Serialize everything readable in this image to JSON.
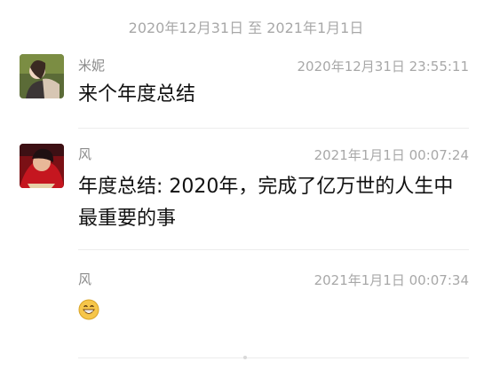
{
  "header": {
    "date_range": "2020年12月31日 至 2021年1月1日"
  },
  "messages": [
    {
      "sender": "米妮",
      "time": "2020年12月31日 23:55:11",
      "text": "来个年度总结",
      "avatar_icon": "user-photo-icon"
    },
    {
      "sender": "风",
      "time": "2021年1月1日 00:07:24",
      "text_line1": "年度总结: 2020年，完成了亿万世的人生中",
      "text_line2": "最重要的事",
      "avatar_icon": "user-photo-icon"
    },
    {
      "sender": "风",
      "time": "2021年1月1日 00:07:34",
      "emoji": "grinning-face-icon"
    }
  ],
  "colors": {
    "muted_text": "#a8a8a8",
    "sender_text": "#8a8a8a",
    "divider": "#ececec",
    "body_text": "#111111",
    "background": "#ffffff"
  }
}
